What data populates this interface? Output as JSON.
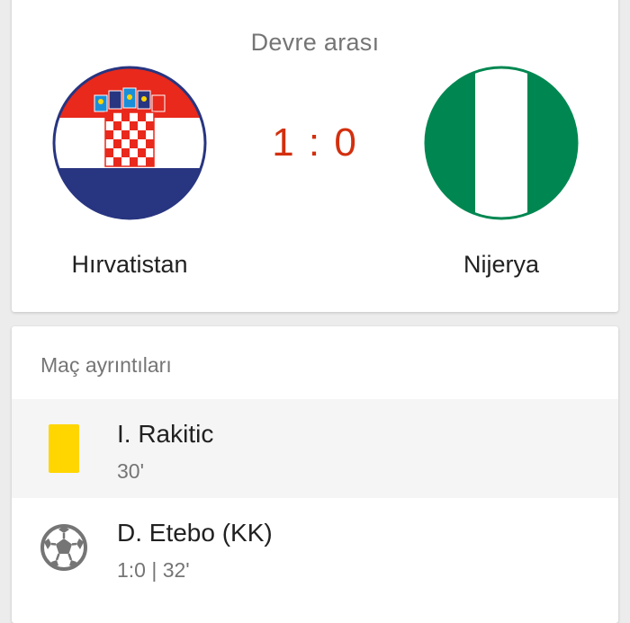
{
  "match": {
    "status": "Devre arası",
    "score": "1 : 0",
    "home_team": "Hırvatistan",
    "away_team": "Nijerya",
    "home_flag_icon": "croatia-flag-icon",
    "away_flag_icon": "nigeria-flag-icon"
  },
  "details": {
    "title": "Maç ayrıntıları",
    "events": [
      {
        "icon": "yellow-card-icon",
        "player": "I. Rakitic",
        "meta": "30'"
      },
      {
        "icon": "soccer-ball-icon",
        "player": "D. Etebo (KK)",
        "meta": "1:0 | 32'"
      }
    ]
  },
  "colors": {
    "score": "#d32f0e",
    "yellow_card": "#ffd600",
    "nigeria_green": "#008751",
    "croatia_red": "#e8291c",
    "croatia_blue": "#283580"
  }
}
